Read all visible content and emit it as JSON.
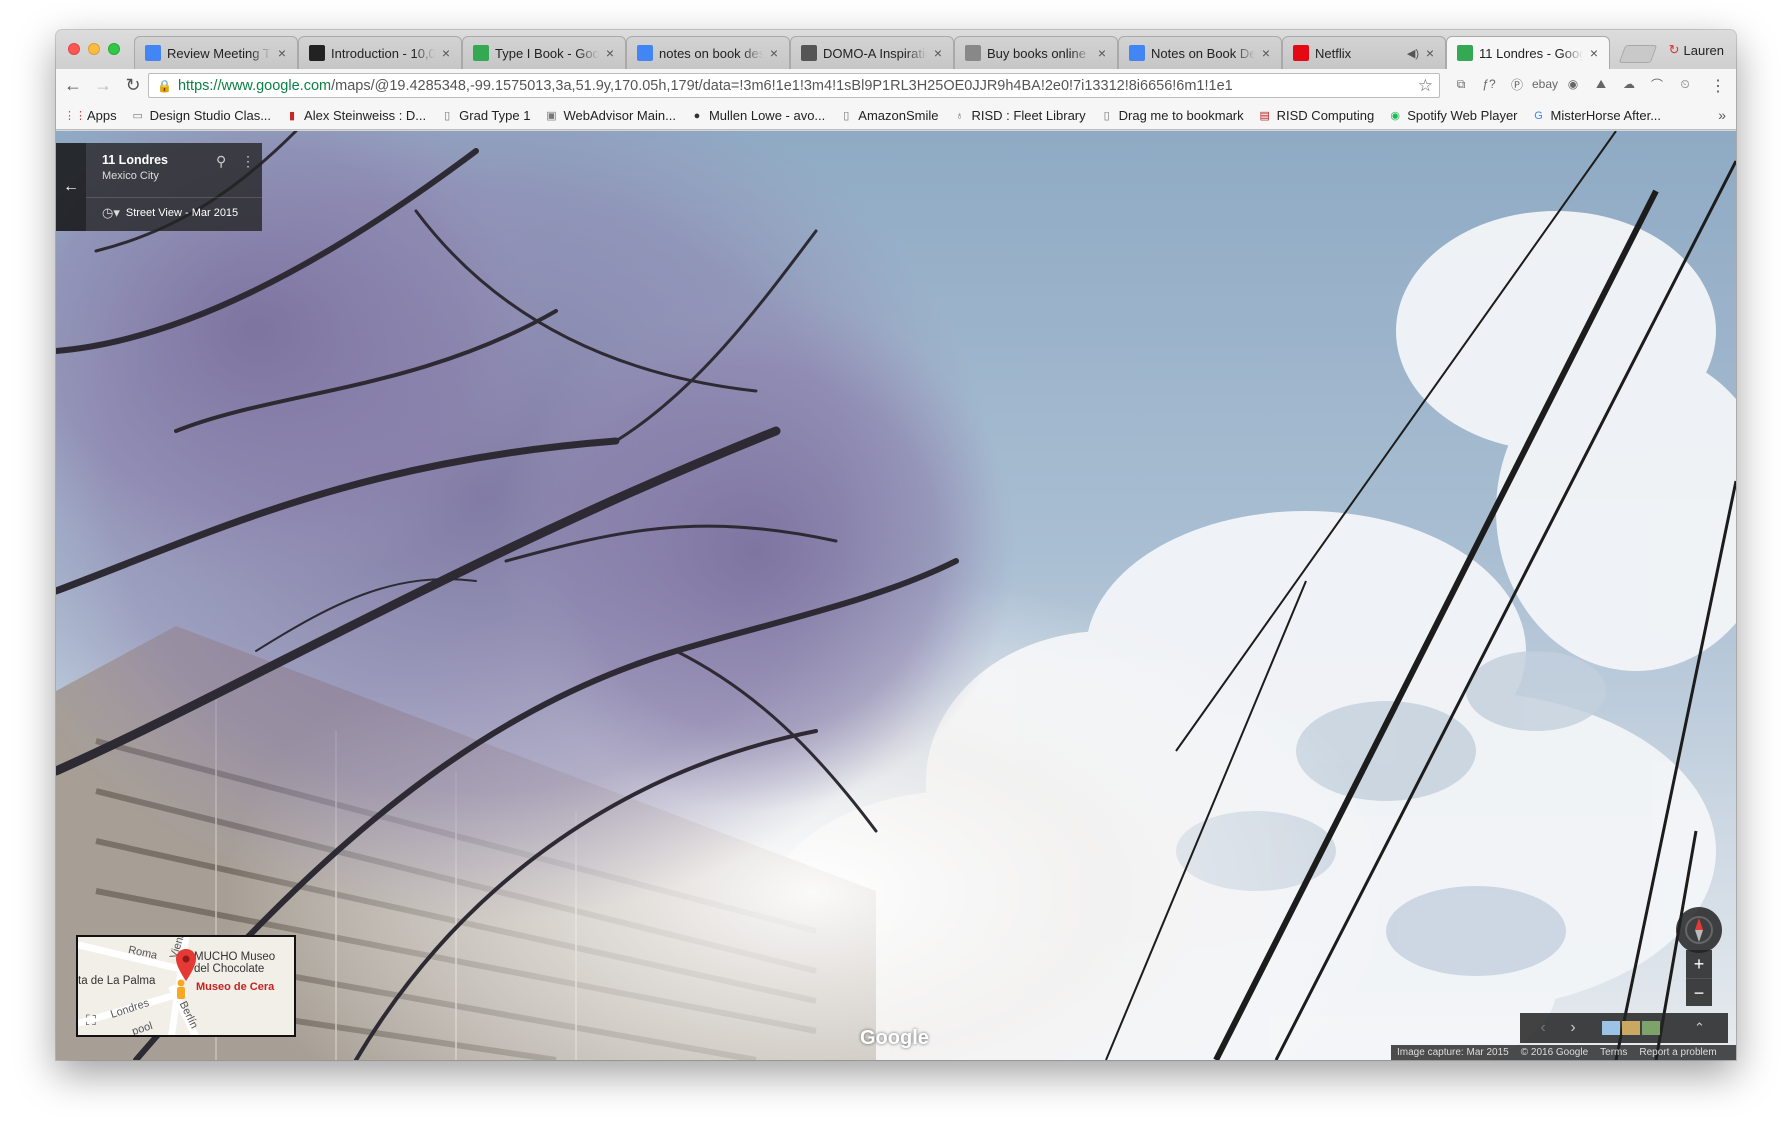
{
  "browser": {
    "profile_name": "Lauren",
    "tabs": [
      {
        "title": "Review Meeting Ti",
        "icon": "google-docs-icon",
        "color": "#4285f4"
      },
      {
        "title": "Introduction - 10,00",
        "icon": "x-icon",
        "color": "#222222"
      },
      {
        "title": "Type I Book - Goog",
        "icon": "google-drive-icon",
        "color": "#34a853"
      },
      {
        "title": "notes on book des",
        "icon": "google-g-icon",
        "color": "#4285f4"
      },
      {
        "title": "DOMO-A Inspiratio",
        "icon": "domo-icon",
        "color": "#555555"
      },
      {
        "title": "Buy books online |",
        "icon": "page-icon",
        "color": "#888888"
      },
      {
        "title": "Notes on Book Des",
        "icon": "google-g-icon",
        "color": "#4285f4"
      },
      {
        "title": "Netflix",
        "icon": "netflix-icon",
        "color": "#e50914"
      },
      {
        "title": "11 Londres - Goog",
        "icon": "google-maps-icon",
        "color": "#34a853"
      }
    ],
    "url_host": "https://www.google.com",
    "url_path": "/maps/@19.4285348,-99.1575013,3a,51.9y,170.05h,179t/data=!3m6!1e1!3m4!1sBl9P1RL3H25OE0JJR9h4BA!2e0!7i13312!8i6656!6m1!1e1",
    "extensions": [
      "cast-icon",
      "font-icon",
      "pinterest-icon",
      "ebay-icon",
      "spotify-icon",
      "drive-icon",
      "cloud-icon",
      "rainbow-icon",
      "clock-icon"
    ],
    "extension_glyphs": [
      "⧉",
      "ƒ?",
      "Ⓟ",
      "ebay",
      "◉",
      "⛰",
      "☁",
      "⌒",
      "⏲"
    ],
    "bookmarks": [
      {
        "label": "Apps",
        "icon": "apps-grid-icon"
      },
      {
        "label": "Design Studio Clas...",
        "icon": "folder-icon"
      },
      {
        "label": "Alex Steinweiss : D...",
        "icon": "bookmark-icon"
      },
      {
        "label": "Grad Type 1",
        "icon": "page-icon"
      },
      {
        "label": "WebAdvisor Main...",
        "icon": "webadvisor-icon"
      },
      {
        "label": "Mullen Lowe - avo...",
        "icon": "mullen-icon"
      },
      {
        "label": "AmazonSmile",
        "icon": "page-icon"
      },
      {
        "label": "RISD : Fleet Library",
        "icon": "risd-icon"
      },
      {
        "label": "Drag me to bookmark",
        "icon": "page-icon"
      },
      {
        "label": "RISD Computing",
        "icon": "risd-computing-icon"
      },
      {
        "label": "Spotify Web Player",
        "icon": "spotify-icon"
      },
      {
        "label": "MisterHorse After...",
        "icon": "google-g-icon"
      }
    ],
    "bookmarks_more": "»"
  },
  "streetview": {
    "place_title": "11 Londres",
    "place_subtitle": "Mexico City",
    "capture_label": "Street View - Mar 2015",
    "watermark": "Google",
    "minimap": {
      "street_labels": [
        "Roma",
        "Viena",
        "Londres",
        "Berlín",
        "pool"
      ],
      "place_left": "ta de La Palma",
      "place_main_line1": "MUCHO Museo",
      "place_main_line2": "del Chocolate",
      "poi": "Museo de Cera"
    },
    "footer": {
      "image_capture": "Image capture: Mar 2015",
      "copyright": "© 2016 Google",
      "terms": "Terms",
      "report": "Report a problem"
    },
    "zoom_in": "+",
    "zoom_out": "−"
  }
}
